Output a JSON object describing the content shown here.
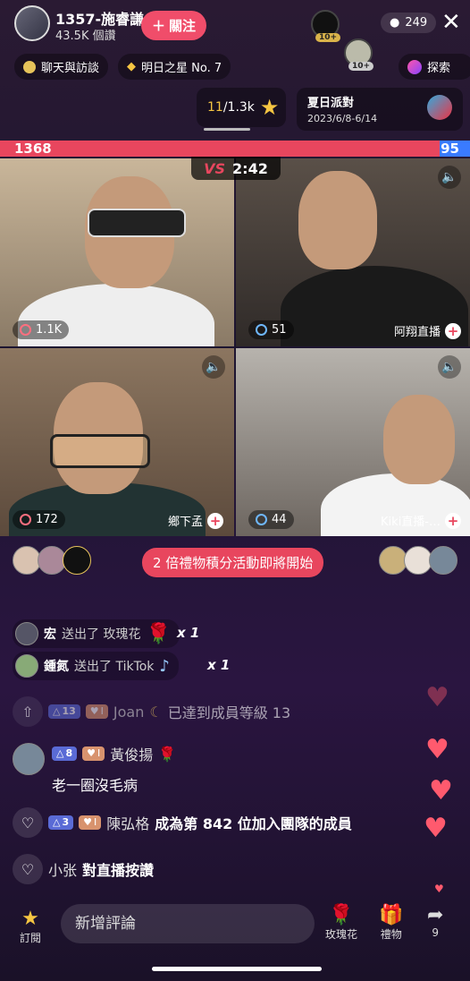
{
  "header": {
    "host_name": "1357-施睿謙",
    "host_sub": "43.5K 個讚",
    "follow_label": "關注",
    "viewer_badge_1": "10+",
    "viewer_badge_2": "10+",
    "viewer_count": "249"
  },
  "chips": {
    "chip1": "聊天與訪談",
    "chip2": "明日之星 No. 7",
    "explore": "探索"
  },
  "rank": {
    "current": "11",
    "total": "/1.3k"
  },
  "event": {
    "title": "夏日派對",
    "dates": "2023/6/8-6/14"
  },
  "score": {
    "red": "1368",
    "blue": "95",
    "red_share": 0.935
  },
  "battle": {
    "timer": "2:42"
  },
  "cells": {
    "c1_count": "1.1K",
    "c2_count": "51",
    "c2_name": "阿翔直播",
    "c3_count": "172",
    "c3_name": "鄉下孟",
    "c4_count": "44",
    "c4_name": "Kiki直播-…"
  },
  "activity": {
    "banner": "2 倍禮物積分活動即將開始"
  },
  "gifts": [
    {
      "user": "宏",
      "action": "送出了 玫瑰花",
      "count": "x 1"
    },
    {
      "user": "鍾氮",
      "action": "送出了 TikTok",
      "count": "x 1"
    }
  ],
  "feed": {
    "joan_level": "13",
    "joan_heart": "I",
    "joan_name": "Joan",
    "joan_msg": "已達到成員等級 13",
    "huang_level": "8",
    "huang_heart": "I",
    "huang_name": "黃俊揚",
    "huang_msg": "老一圈沒毛病",
    "chen_level": "3",
    "chen_heart": "I",
    "chen_name": "陳弘格",
    "chen_msg": "成為第 842 位加入團隊的成員",
    "xiao_name": "小张",
    "xiao_msg": "對直播按讚"
  },
  "bottom": {
    "subscribe": "訂閱",
    "input_placeholder": "新增評論",
    "rose": "玫瑰花",
    "gift": "禮物",
    "share_count": "9"
  }
}
